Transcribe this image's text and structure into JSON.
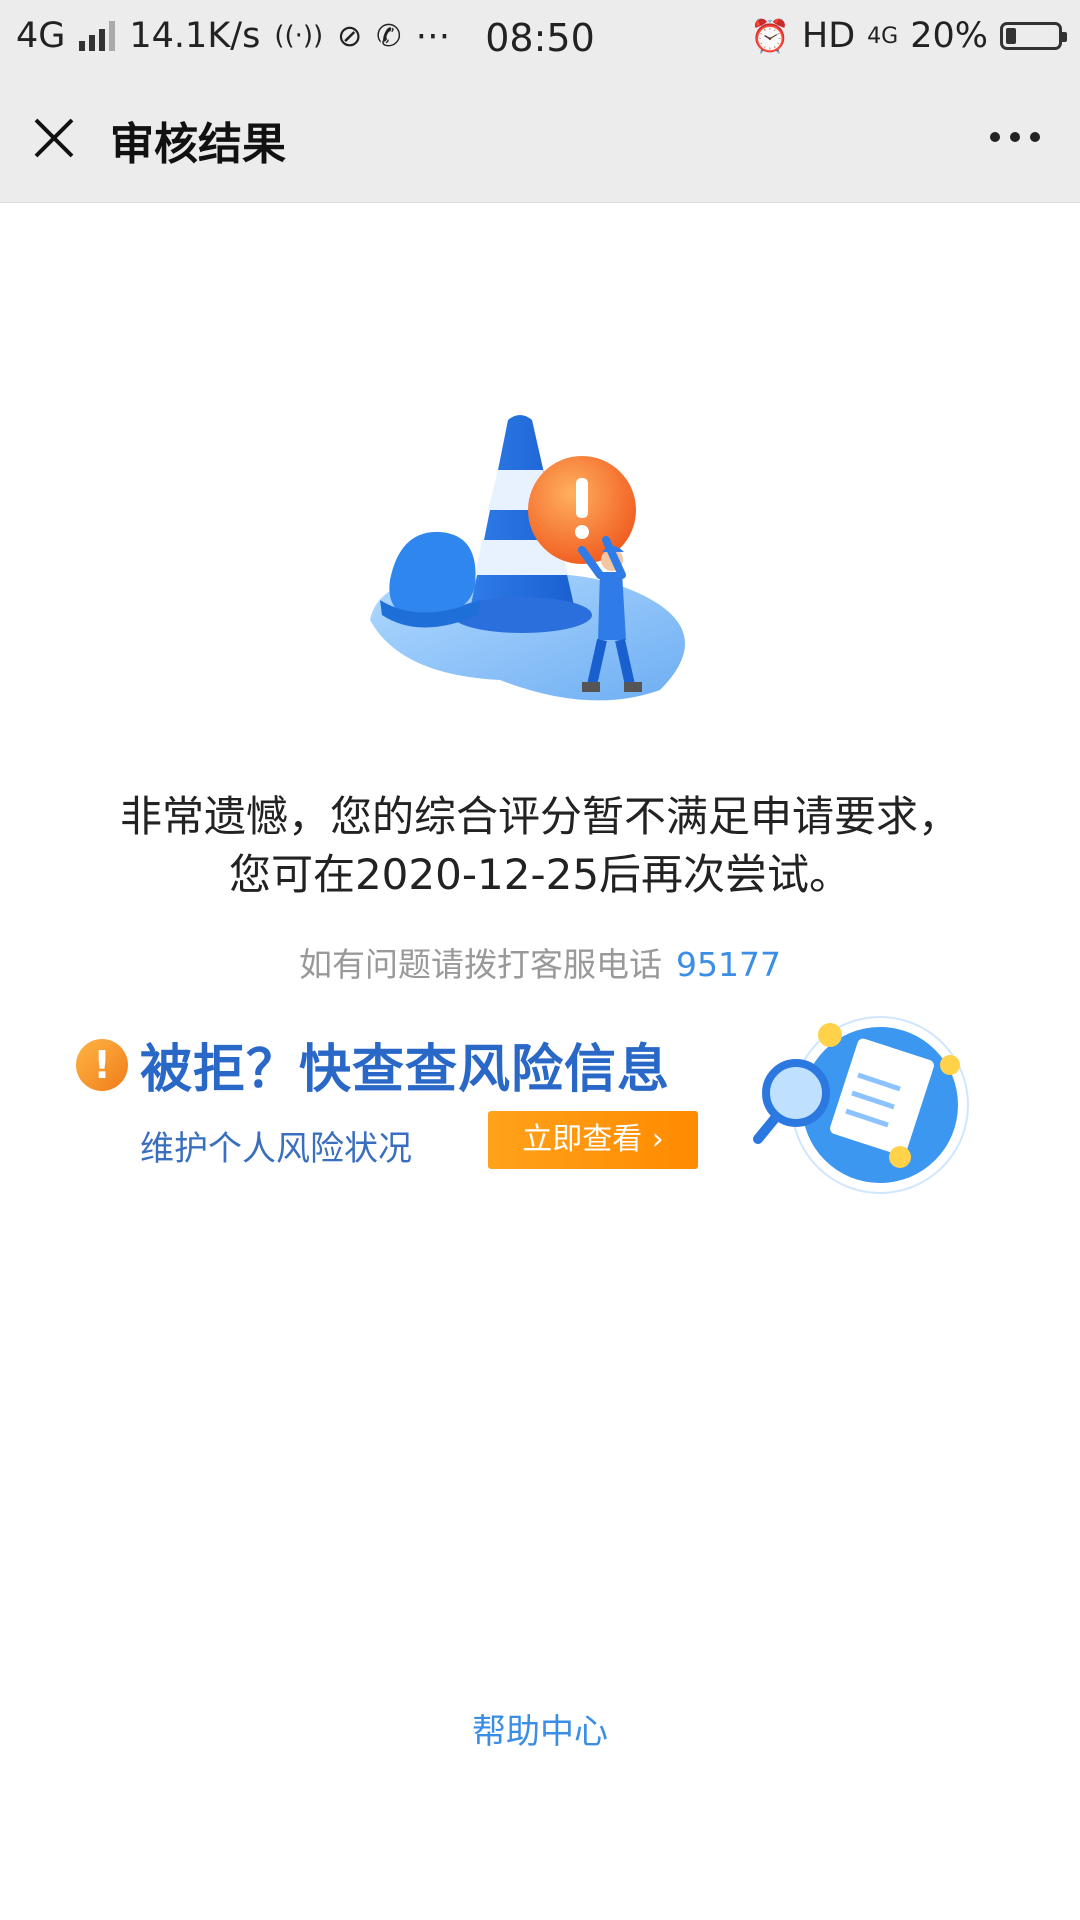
{
  "status_bar": {
    "network": "4G",
    "speed": "14.1K/s",
    "extra_icons": "⋯",
    "time": "08:50",
    "hd": "HD",
    "net2": "4G",
    "battery": "20%",
    "battery_level": 0.2
  },
  "nav": {
    "title": "审核结果"
  },
  "result": {
    "message": "非常遗憾，您的综合评分暂不满足申请要求，您可在2020-12-25后再次尝试。",
    "contact_prefix": "如有问题请拨打客服电话",
    "contact_phone": "95177"
  },
  "banner": {
    "title": "被拒？快查查风险信息",
    "subtitle": "维护个人风险状况",
    "button": "立即查看 ›"
  },
  "footer": {
    "help": "帮助中心"
  },
  "colors": {
    "accent_blue": "#3b8ee6",
    "banner_blue": "#2a68c7",
    "button_orange": "#ff9a10",
    "warning_orange": "#f07c1a"
  },
  "icons": {
    "close": "close-icon",
    "more": "more-icon",
    "warning": "warning-icon"
  }
}
